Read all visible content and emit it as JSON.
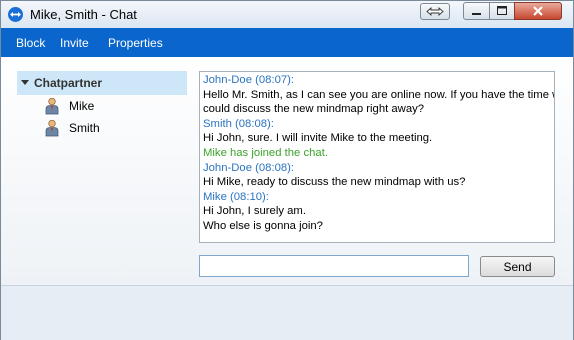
{
  "window": {
    "title": "Mike, Smith - Chat"
  },
  "menu": {
    "items": [
      "Block",
      "Invite",
      "Properties"
    ]
  },
  "sidebar": {
    "group_label": "Chatpartner",
    "partners": [
      "Mike",
      "Smith"
    ]
  },
  "chat": {
    "lines": [
      {
        "kind": "sender",
        "text": "John-Doe (08:07):"
      },
      {
        "kind": "message",
        "text": "Hello Mr. Smith, as I can see you are online now. If you have the time we"
      },
      {
        "kind": "message",
        "text": "could discuss the new mindmap right away?"
      },
      {
        "kind": "sender",
        "text": "Smith (08:08):"
      },
      {
        "kind": "message",
        "text": "Hi John, sure. I will invite Mike to the meeting."
      },
      {
        "kind": "event",
        "text": "Mike has joined the chat."
      },
      {
        "kind": "sender",
        "text": "John-Doe (08:08):"
      },
      {
        "kind": "message",
        "text": "Hi Mike, ready to discuss the new mindmap with us?"
      },
      {
        "kind": "sender",
        "text": "Mike (08:10):"
      },
      {
        "kind": "message",
        "text": "Hi John, I surely am."
      },
      {
        "kind": "message",
        "text": "Who else is gonna join?"
      }
    ]
  },
  "compose": {
    "value": "",
    "send_label": "Send"
  },
  "colors": {
    "menubar": "#0a66cc",
    "sender": "#2a74c1",
    "event": "#3aa32b",
    "partner_header": "#cde7f8"
  },
  "icons": {
    "app": "teamviewer-icon",
    "partner": "person-icon"
  }
}
